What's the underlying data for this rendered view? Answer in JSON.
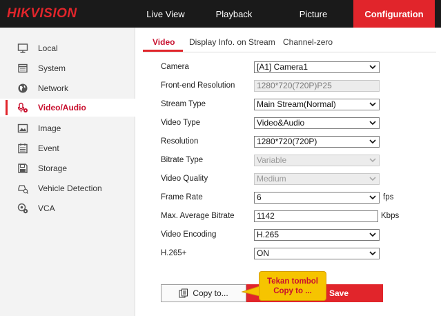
{
  "brand": {
    "logo_text": "HIKVISION",
    "accent": "#e1252b"
  },
  "nav": {
    "items": [
      "Live View",
      "Playback",
      "Picture",
      "Configuration"
    ],
    "active": "Configuration"
  },
  "sidebar": {
    "items": [
      {
        "label": "Local",
        "icon": "monitor-icon"
      },
      {
        "label": "System",
        "icon": "window-icon"
      },
      {
        "label": "Network",
        "icon": "globe-icon"
      },
      {
        "label": "Video/Audio",
        "icon": "microphone-gear-icon",
        "active": true
      },
      {
        "label": "Image",
        "icon": "image-icon"
      },
      {
        "label": "Event",
        "icon": "calendar-icon"
      },
      {
        "label": "Storage",
        "icon": "disk-icon"
      },
      {
        "label": "Vehicle Detection",
        "icon": "vehicle-search-icon"
      },
      {
        "label": "VCA",
        "icon": "vca-gear-icon"
      }
    ]
  },
  "tabs": [
    "Video",
    "Display Info. on Stream",
    "Channel-zero"
  ],
  "form": {
    "camera": {
      "label": "Camera",
      "value": "[A1] Camera1"
    },
    "front_end_resolution": {
      "label": "Front-end Resolution",
      "value": "1280*720(720P)P25"
    },
    "stream_type": {
      "label": "Stream Type",
      "value": "Main Stream(Normal)"
    },
    "video_type": {
      "label": "Video Type",
      "value": "Video&Audio"
    },
    "resolution": {
      "label": "Resolution",
      "value": "1280*720(720P)"
    },
    "bitrate_type": {
      "label": "Bitrate Type",
      "value": "Variable"
    },
    "video_quality": {
      "label": "Video Quality",
      "value": "Medium"
    },
    "frame_rate": {
      "label": "Frame Rate",
      "value": "6",
      "unit": "fps"
    },
    "max_avg_bitrate": {
      "label": "Max. Average Bitrate",
      "value": "1142",
      "unit": "Kbps"
    },
    "video_encoding": {
      "label": "Video Encoding",
      "value": "H.265"
    },
    "h265plus": {
      "label": "H.265+",
      "value": "ON"
    }
  },
  "buttons": {
    "copy": "Copy to...",
    "save": "Save"
  },
  "callout": {
    "line1": "Tekan tombol",
    "line2": "Copy to ...",
    "bg": "#f6c400",
    "text_color": "#c8102e"
  }
}
